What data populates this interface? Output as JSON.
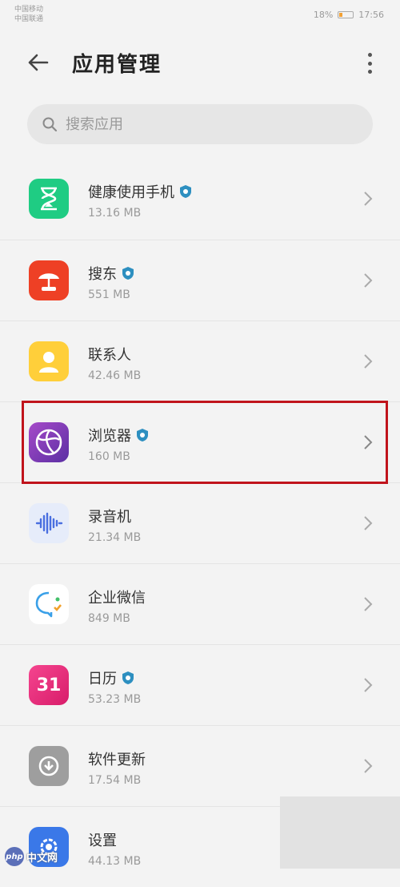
{
  "status_bar": {
    "left_line1": "中国移动",
    "left_line2": "中国联通",
    "right_text": "18%",
    "time": "17:56"
  },
  "header": {
    "title": "应用管理"
  },
  "search": {
    "placeholder": "搜索应用"
  },
  "apps": [
    {
      "name": "健康使用手机",
      "size": "13.16 MB",
      "verified": true,
      "icon": "hourglass-icon",
      "color": "#1fcc83"
    },
    {
      "name": "搜东",
      "size": "551 MB",
      "verified": true,
      "icon": "umbrella-icon",
      "color": "#ee4025"
    },
    {
      "name": "联系人",
      "size": "42.46 MB",
      "verified": false,
      "icon": "contact-icon",
      "color": "#ffcf3a"
    },
    {
      "name": "浏览器",
      "size": "160 MB",
      "verified": true,
      "icon": "browser-globe-icon",
      "color": "#7b3fb6"
    },
    {
      "name": "录音机",
      "size": "21.34 MB",
      "verified": false,
      "icon": "waveform-icon",
      "color": "#e6ecfa"
    },
    {
      "name": "企业微信",
      "size": "849 MB",
      "verified": false,
      "icon": "wecom-icon",
      "color": "#ffffff"
    },
    {
      "name": "日历",
      "size": "53.23 MB",
      "verified": true,
      "icon": "calendar-icon",
      "color": "#f0277e",
      "badge": "31"
    },
    {
      "name": "软件更新",
      "size": "17.54 MB",
      "verified": false,
      "icon": "update-icon",
      "color": "#9e9e9e"
    },
    {
      "name": "设置",
      "size": "44.13 MB",
      "verified": false,
      "icon": "settings-icon",
      "color": "#3a78e8"
    }
  ],
  "watermark": {
    "badge": "php",
    "text": "中文网"
  },
  "colors": {
    "highlight": "#c0141c",
    "verified": "#2d8fc0"
  }
}
